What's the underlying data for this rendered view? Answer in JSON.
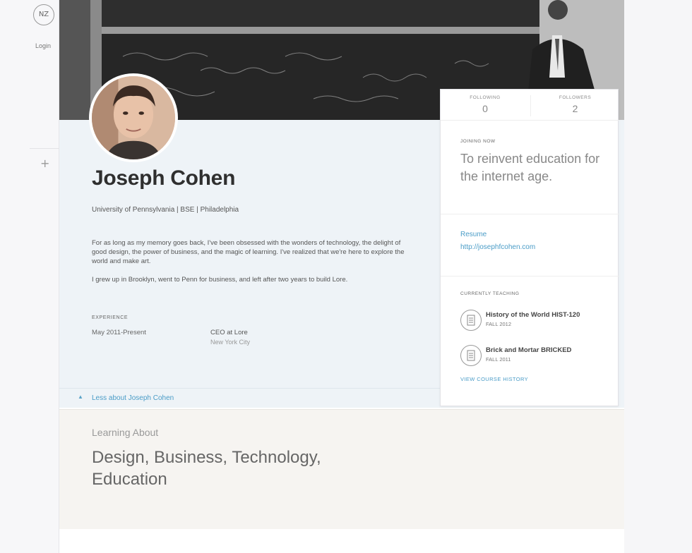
{
  "rail": {
    "logo_text": "NZ",
    "login_label": "Login",
    "plus_glyph": "+"
  },
  "profile": {
    "name": "Joseph Cohen",
    "subline": "University of Pennsylvania | BSE | Philadelphia",
    "bio": [
      "For as long as my memory goes back, I've been obsessed with the wonders of technology, the delight of good design, the power of business, and the magic of learning. I've realized that we're here to explore the world and make art.",
      "I grew up in Brooklyn, went to Penn for business, and left after two years to build Lore."
    ],
    "experience_label": "Experience",
    "experience": {
      "dates": "May 2011-Present",
      "role": "CEO at Lore",
      "location": "New York City"
    },
    "less_link": "Less about Joseph Cohen"
  },
  "card": {
    "stats": [
      {
        "label": "Following",
        "value": "0"
      },
      {
        "label": "Followers",
        "value": "2"
      }
    ],
    "mission_label": "Joining Now",
    "mission": "To reinvent education for the internet age.",
    "resume_label": "Resume",
    "resume_url": "http://josephfcohen.com",
    "teaching_label": "Currently Teaching",
    "courses": [
      {
        "title": "History of the World HIST-120",
        "term": "FALL 2012",
        "icon": "book-icon"
      },
      {
        "title": "Brick and Mortar BRICKED",
        "term": "FALL 2011",
        "icon": "book-icon"
      }
    ],
    "history_link": "View course history"
  },
  "learning": {
    "label": "Learning About",
    "topics": "Design, Business, Technology, Education"
  },
  "colors": {
    "link": "#4a9cc7",
    "profile_bg": "#eef3f7",
    "learning_bg": "#f6f4f1"
  }
}
